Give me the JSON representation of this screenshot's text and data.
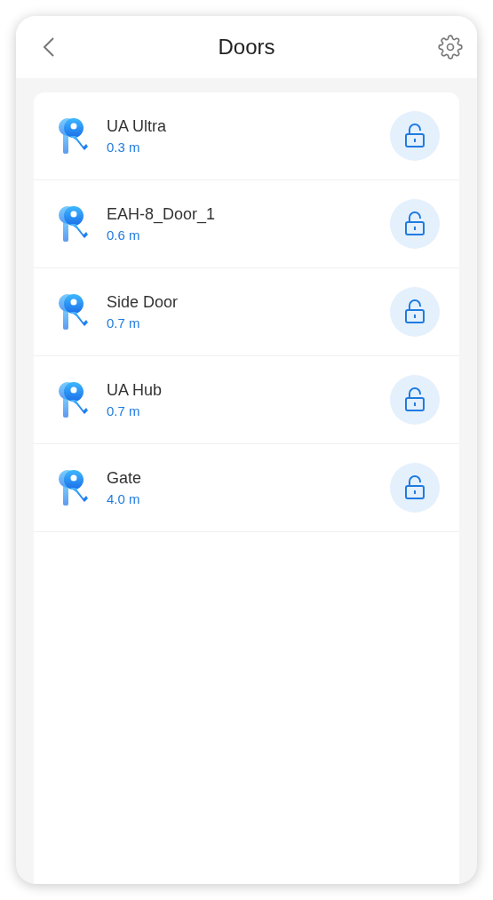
{
  "header": {
    "title": "Doors"
  },
  "doors": [
    {
      "name": "UA Ultra",
      "distance": "0.3 m"
    },
    {
      "name": "EAH-8_Door_1",
      "distance": "0.6 m"
    },
    {
      "name": "Side Door",
      "distance": "0.7 m"
    },
    {
      "name": "UA Hub",
      "distance": "0.7 m"
    },
    {
      "name": "Gate",
      "distance": "4.0 m"
    }
  ]
}
